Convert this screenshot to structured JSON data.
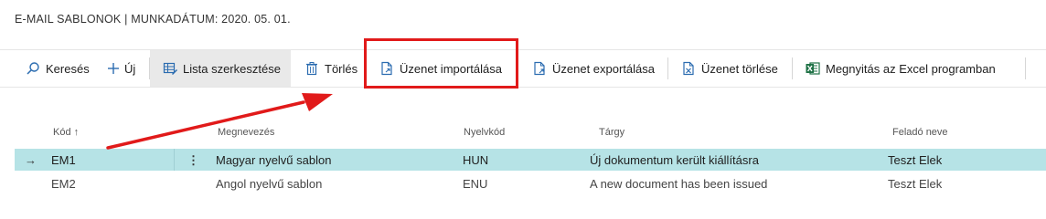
{
  "page": {
    "title": "E-MAIL SABLONOK | MUNKADÁTUM: 2020. 05. 01."
  },
  "actions": {
    "search": "Keresés",
    "new": "Új",
    "edit_list": "Lista szerkesztése",
    "delete": "Törlés",
    "import_message": "Üzenet importálása",
    "export_message": "Üzenet exportálása",
    "delete_message": "Üzenet törlése",
    "open_excel": "Megnyitás az Excel programban"
  },
  "table": {
    "columns": {
      "code": "Kód ↑",
      "name": "Megnevezés",
      "language": "Nyelvkód",
      "subject": "Tárgy",
      "sender": "Feladó neve"
    },
    "rows": [
      {
        "code": "EM1",
        "name": "Magyar nyelvű sablon",
        "language": "HUN",
        "subject": "Új dokumentum került kiállításra",
        "sender": "Teszt Elek",
        "selected": true
      },
      {
        "code": "EM2",
        "name": "Angol nyelvű sablon",
        "language": "ENU",
        "subject": "A new document has been issued",
        "sender": "Teszt Elek",
        "selected": false
      }
    ]
  },
  "colors": {
    "selected_row": "#b6e3e6",
    "annotation_red": "#e11a1a",
    "excel_green": "#1e7145",
    "accent_blue": "#2b6cb0"
  }
}
